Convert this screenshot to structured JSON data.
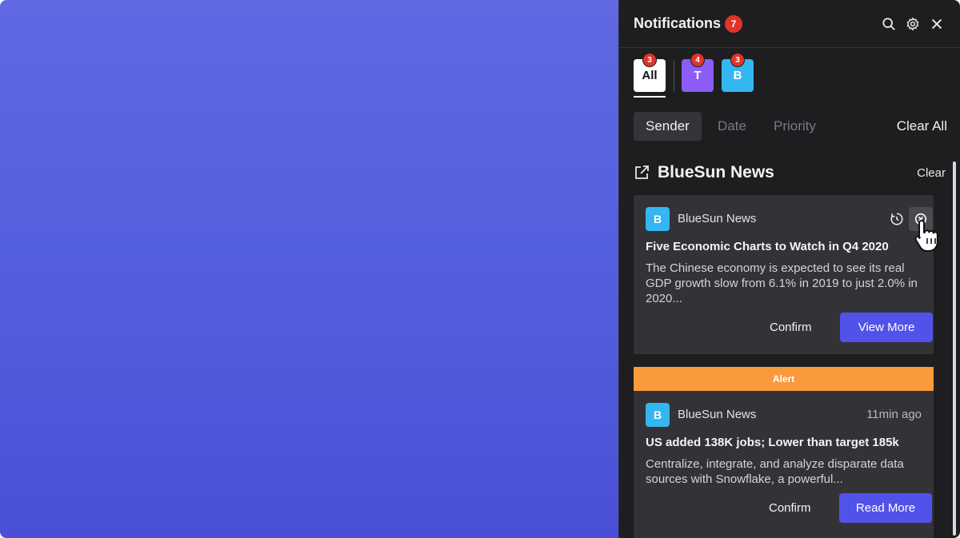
{
  "panel": {
    "title": "Notifications",
    "unread_count": "7",
    "icons": {
      "search": "search-icon",
      "settings": "gear-icon",
      "close": "close-icon"
    }
  },
  "filters": [
    {
      "label": "All",
      "badge": "3",
      "color": "#ffffff"
    },
    {
      "label": "T",
      "badge": "4",
      "color": "#8b5cf6"
    },
    {
      "label": "B",
      "badge": "3",
      "color": "#34b6f0"
    }
  ],
  "sort_tabs": [
    "Sender",
    "Date",
    "Priority"
  ],
  "active_sort": "Sender",
  "clear_all_label": "Clear All",
  "group": {
    "title": "BlueSun News",
    "clear_label": "Clear"
  },
  "notifications": [
    {
      "avatar": "B",
      "sender": "BlueSun News",
      "headline": "Five Economic Charts to Watch in Q4 2020",
      "body": "The Chinese economy is expected to see its real GDP growth slow from 6.1% in 2019 to just 2.0% in 2020...",
      "confirm_label": "Confirm",
      "action_label": "View More"
    },
    {
      "tag": "Alert",
      "avatar": "B",
      "sender": "BlueSun News",
      "time": "11min ago",
      "headline": "US added 138K jobs; Lower than target 185k",
      "body": "Centralize, integrate, and analyze disparate data sources with Snowflake, a powerful...",
      "confirm_label": "Confirm",
      "action_label": "Read More"
    }
  ],
  "colors": {
    "desktop_top": "#6068e2",
    "desktop_bottom": "#4a50d6",
    "panel_bg": "#1e1e20",
    "card_bg": "#333337",
    "badge_red": "#e0342b",
    "alert_orange": "#fb9a3c",
    "primary_button": "#5152ea"
  }
}
